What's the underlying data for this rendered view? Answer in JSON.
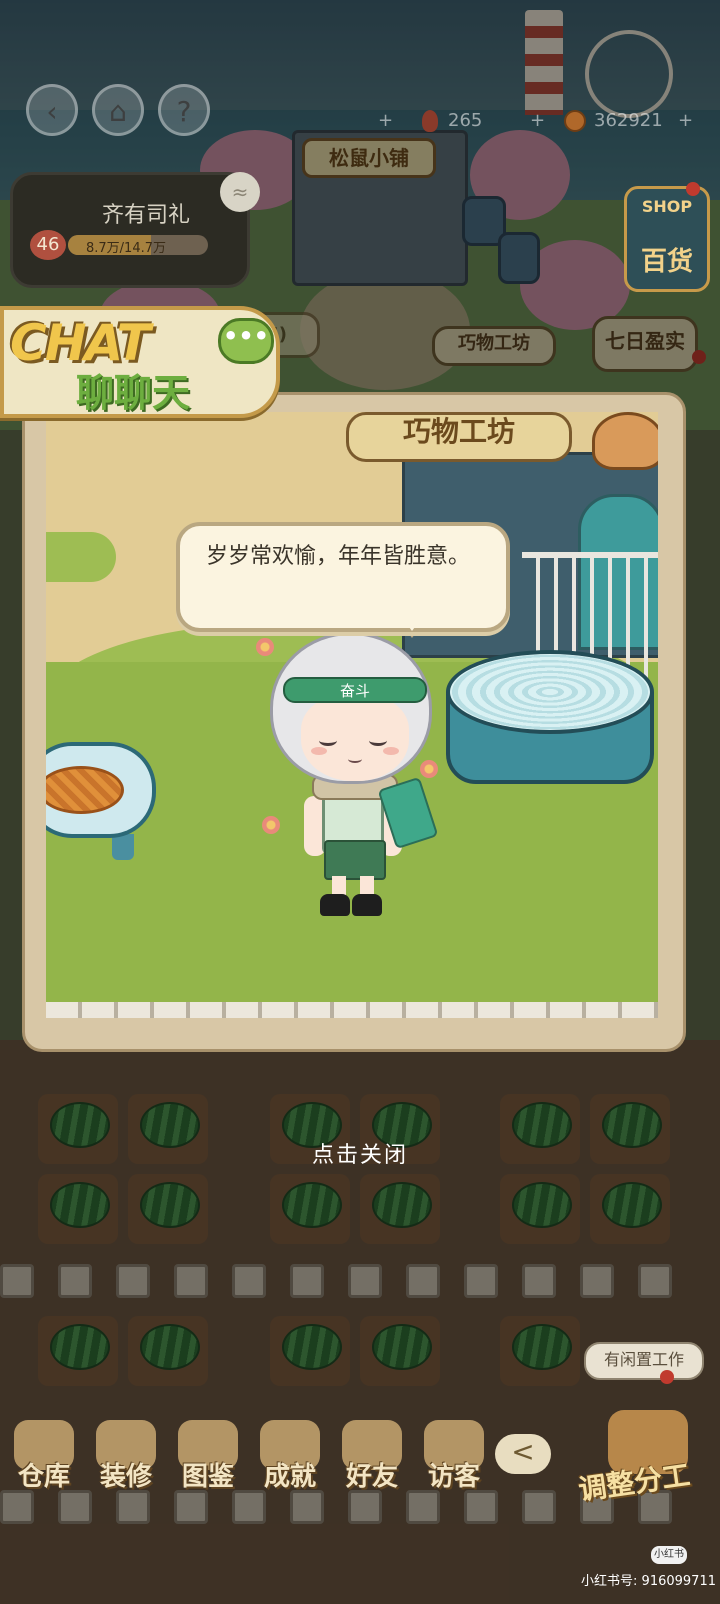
{
  "top_bar": {
    "ember_count": "265",
    "coin_count": "362921",
    "plus": "+"
  },
  "player": {
    "name": "齐有司礼",
    "level": "46",
    "xp_text": "8.7万/14.7万",
    "xp_fraction": 0.59
  },
  "scene_signs": {
    "squirrel_shop": "松鼠小铺",
    "craft_workshop": "巧物工坊",
    "seven_day": "七日盈实",
    "hidden_count_fragment": "45)"
  },
  "shop_button": {
    "en": "SHOP",
    "cn": "百货"
  },
  "chat_banner": {
    "en": "CHAT",
    "cn": "聊聊天",
    "dots": "•••"
  },
  "chat_panel": {
    "sign": "巧物工坊",
    "headband_text": "奋斗",
    "message": "岁岁常欢愉，年年皆胜意。"
  },
  "close_hint": "点击关闭",
  "dock": {
    "items": [
      {
        "label": "仓库"
      },
      {
        "label": "装修"
      },
      {
        "label": "图鉴"
      },
      {
        "label": "成就"
      },
      {
        "label": "好友"
      },
      {
        "label": "访客"
      }
    ],
    "collapse": "<",
    "assign_label": "调整分工",
    "idle_tag": "有闲置工作"
  },
  "watermark": {
    "logo": "小红书",
    "id": "小红书号: 916099711"
  }
}
